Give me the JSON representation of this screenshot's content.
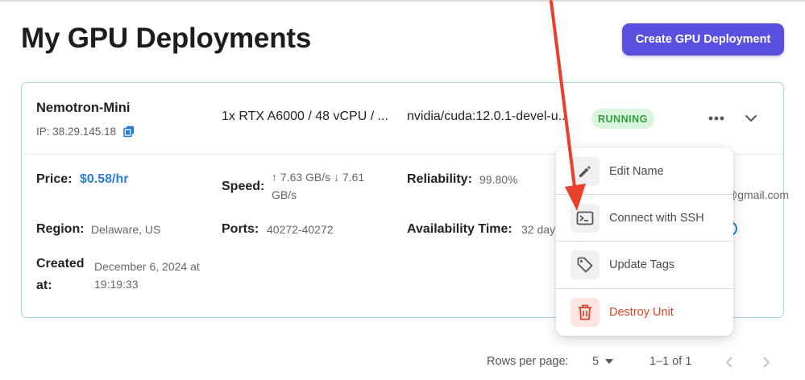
{
  "page": {
    "title": "My GPU Deployments"
  },
  "header": {
    "create_button_label": "Create GPU Deployment"
  },
  "deployment": {
    "name": "Nemotron-Mini",
    "ip_text": "IP: 38.29.145.18",
    "gpu_spec": "1x RTX A6000 / 48 vCPU / ...",
    "image": "nvidia/cuda:12.0.1-devel-u...",
    "status": "RUNNING",
    "details": {
      "price_label": "Price:",
      "price_value": "$0.58/hr",
      "speed_label": "Speed:",
      "speed_value_line1": "↑ 7.63 GB/s ↓ 7.61",
      "speed_value_line2": "GB/s",
      "reliability_label": "Reliability:",
      "reliability_value": "99.80%",
      "region_label": "Region:",
      "region_value": "Delaware, US",
      "ports_label": "Ports:",
      "ports_value": "40272-40272",
      "availability_label": "Availability Time:",
      "availability_value": "32 day",
      "created_label_line1": "Created",
      "created_label_line2": "at:",
      "created_value_line1": "December 6, 2024 at",
      "created_value_line2": "19:19:33",
      "email_fragment": "@gmail.com"
    }
  },
  "menu": {
    "items": [
      {
        "label": "Edit Name",
        "icon": "pencil-icon"
      },
      {
        "label": "Connect with SSH",
        "icon": "terminal-icon"
      },
      {
        "label": "Update Tags",
        "icon": "tag-icon"
      },
      {
        "label": "Destroy Unit",
        "icon": "trash-icon",
        "danger": true
      }
    ]
  },
  "pagination": {
    "rows_per_page_label": "Rows per page:",
    "rows_per_page_value": "5",
    "range_text": "1–1 of 1"
  },
  "colors": {
    "accent": "#5b4fe0",
    "status_running_bg": "#d9f5dc",
    "status_running_text": "#2f9e45",
    "price": "#2a7fd0",
    "danger": "#d2452b",
    "annotation_arrow": "#e8402c",
    "card_border": "#a9d3ea"
  }
}
